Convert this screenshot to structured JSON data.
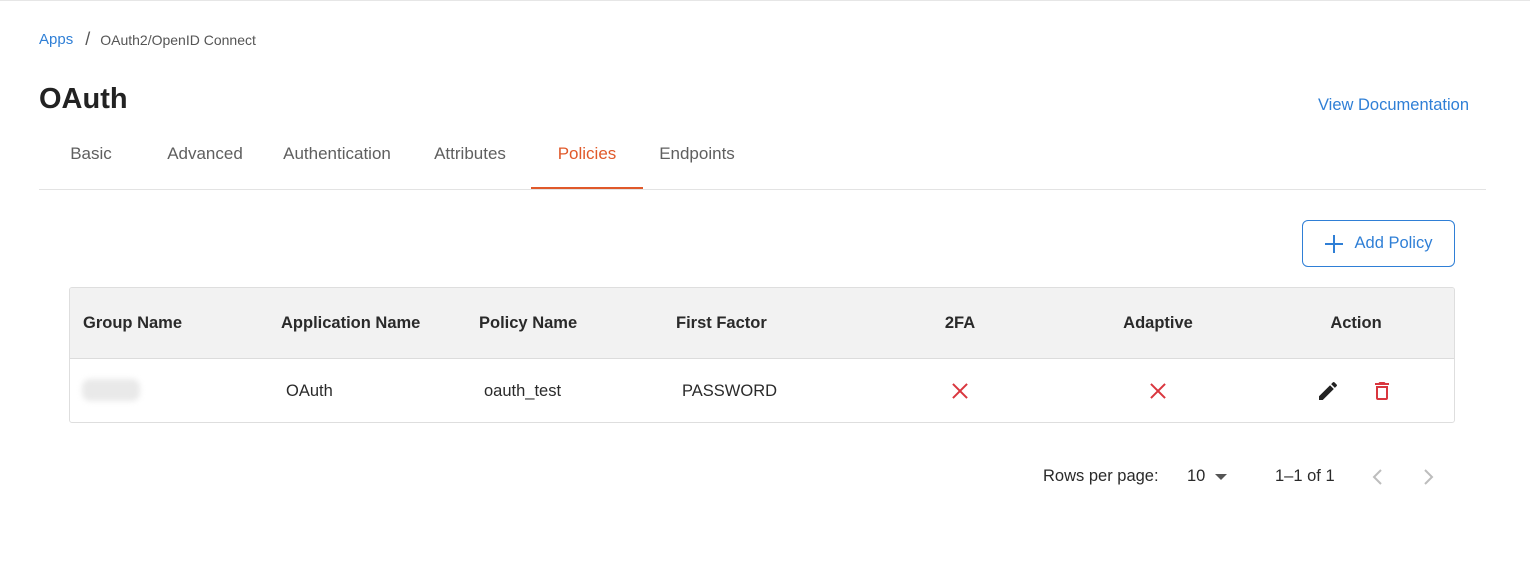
{
  "breadcrumb": {
    "root": "Apps",
    "separator": "/",
    "current": "OAuth2/OpenID Connect"
  },
  "page": {
    "title": "OAuth",
    "doc_link": "View Documentation"
  },
  "tabs": [
    {
      "label": "Basic"
    },
    {
      "label": "Advanced"
    },
    {
      "label": "Authentication"
    },
    {
      "label": "Attributes"
    },
    {
      "label": "Policies",
      "active": true
    },
    {
      "label": "Endpoints"
    }
  ],
  "toolbar": {
    "add_label": "Add Policy",
    "add_icon": "plus-icon"
  },
  "table": {
    "columns": [
      "Group Name",
      "Application Name",
      "Policy Name",
      "First Factor",
      "2FA",
      "Adaptive",
      "Action"
    ],
    "rows": [
      {
        "group_name": "",
        "application_name": "OAuth",
        "policy_name": "oauth_test",
        "first_factor": "PASSWORD",
        "two_fa": false,
        "adaptive": false,
        "actions": [
          "edit-icon",
          "delete-icon"
        ]
      }
    ]
  },
  "pagination": {
    "rows_label": "Rows per page:",
    "rows_value": "10",
    "range": "1–1 of 1"
  },
  "colors": {
    "accent": "#2f7fd6",
    "active_tab": "#e0592a",
    "danger": "#d9363e"
  }
}
